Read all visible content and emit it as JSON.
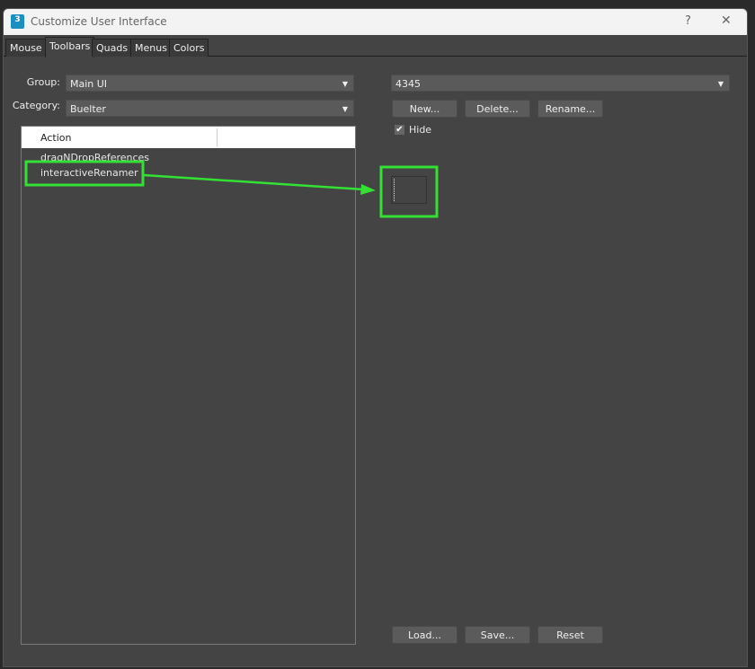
{
  "window": {
    "title": "Customize User Interface",
    "app_icon": "3",
    "help": "?",
    "close": "✕"
  },
  "tabs": [
    "Mouse",
    "Toolbars",
    "Quads",
    "Menus",
    "Colors"
  ],
  "left": {
    "group_label": "Group:",
    "group_value": "Main UI",
    "category_label": "Category:",
    "category_value": "Buelter",
    "list_header": "Action",
    "items": [
      "dragNDropReferences",
      "interactiveRenamer"
    ]
  },
  "right": {
    "toolbar_value": "4345",
    "new": "New...",
    "delete": "Delete...",
    "rename": "Rename...",
    "hide_label": "Hide",
    "hide_checked": true,
    "load": "Load...",
    "save": "Save...",
    "reset": "Reset"
  },
  "colors": {
    "highlight": "#33e033"
  }
}
